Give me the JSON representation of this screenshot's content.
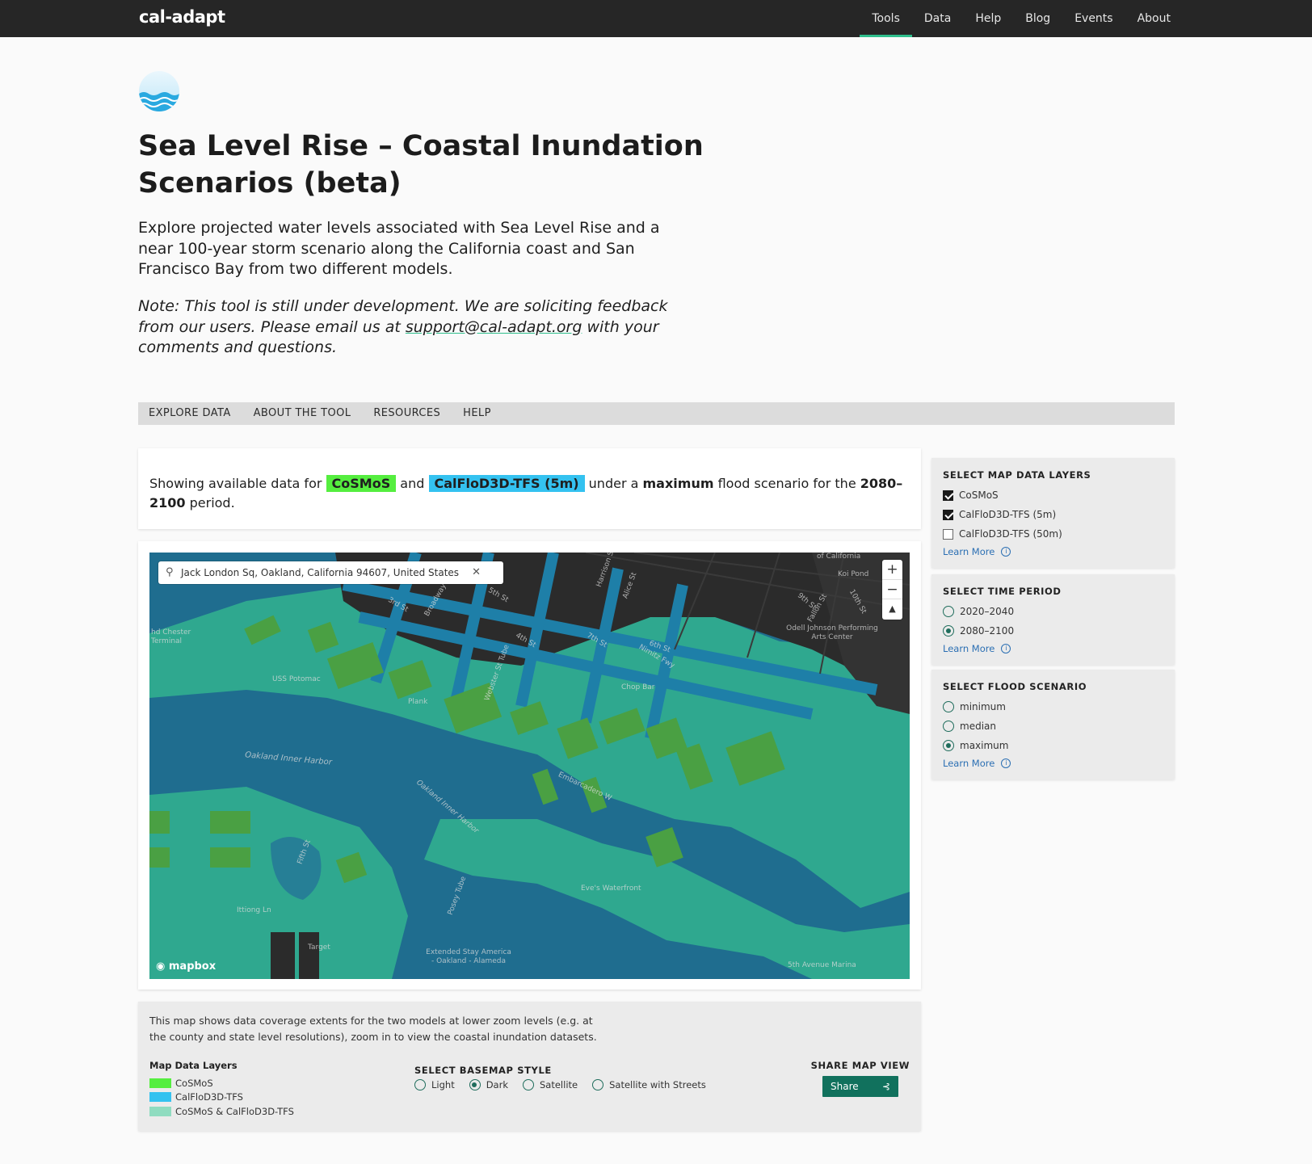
{
  "brand": {
    "logo": "cal-adapt"
  },
  "nav": {
    "items": [
      "Tools",
      "Data",
      "Help",
      "Blog",
      "Events",
      "About"
    ]
  },
  "header": {
    "title": "Sea Level Rise – Coastal Inundation Scenarios (beta)",
    "intro": "Explore projected water levels associated with Sea Level Rise and a near 100-year storm scenario along the California coast and San Francisco Bay from two different models.",
    "note_before": "Note: This tool is still under development. We are soliciting feedback from our users. Please email us at ",
    "note_link": "support@cal-adapt.org",
    "note_after": " with your comments and questions."
  },
  "tabs": [
    "EXPLORE DATA",
    "ABOUT THE TOOL",
    "RESOURCES",
    "HELP"
  ],
  "summary": {
    "prefix": "Showing available data for ",
    "model1": "CoSMoS",
    "and": " and ",
    "model2": "CalFloD3D-TFS (5m)",
    "mid": " under a ",
    "scenario": "maximum",
    "mid2": " flood scenario for the ",
    "period": "2080–2100",
    "suffix": " period."
  },
  "map": {
    "search_value": "Jack London Sq, Oakland, California 94607, United States",
    "zoom_in": "+",
    "zoom_out": "−",
    "compass": "▲",
    "attribution": "mapbox",
    "labels": [
      "Oakland Inner Harbor",
      "USS Potomac",
      "Chop Bar",
      "Eve's Waterfront",
      "Odell Johnson Performing Arts Center",
      "Nimitz Fwy",
      "Embarcadero W",
      "Webster St Tube",
      "Alice St",
      "Harrison St",
      "Broadway",
      "5th St",
      "6th St",
      "3rd St",
      "4th St",
      "7th St",
      "9th St",
      "10th St",
      "Fallon St",
      "Target",
      "Extended Stay America - Oakland - Alameda",
      "5th Avenue Marina",
      "Oakland Inner Harbor",
      "Posey Tube",
      "Fifth St",
      "Ittiong Ln",
      "hd Chester Terminal",
      "of California",
      "Koi Pond",
      "Plank"
    ]
  },
  "legend": {
    "description": "This map shows data coverage extents for the two models at lower zoom levels (e.g. at the county and state level resolutions), zoom in to view the coastal inundation datasets.",
    "title": "Map Data Layers",
    "items": [
      {
        "label": "CoSMoS",
        "color": "#55ee3f"
      },
      {
        "label": "CalFloD3D-TFS",
        "color": "#34c2f0"
      },
      {
        "label": "CoSMoS & CalFloD3D-TFS",
        "color": "#8fdcc0"
      }
    ]
  },
  "basemap": {
    "title": "SELECT BASEMAP STYLE",
    "options": [
      "Light",
      "Dark",
      "Satellite",
      "Satellite with Streets"
    ],
    "selected": "Dark"
  },
  "share": {
    "title": "SHARE MAP VIEW",
    "button": "Share"
  },
  "layers_panel": {
    "title": "SELECT MAP DATA LAYERS",
    "options": [
      {
        "label": "CoSMoS",
        "checked": true
      },
      {
        "label": "CalFloD3D-TFS (5m)",
        "checked": true
      },
      {
        "label": "CalFloD3D-TFS (50m)",
        "checked": false
      }
    ],
    "learn_more": "Learn More"
  },
  "time_panel": {
    "title": "SELECT TIME PERIOD",
    "options": [
      "2020–2040",
      "2080–2100"
    ],
    "selected": "2080–2100",
    "learn_more": "Learn More"
  },
  "flood_panel": {
    "title": "SELECT FLOOD SCENARIO",
    "options": [
      "minimum",
      "median",
      "maximum"
    ],
    "selected": "maximum",
    "learn_more": "Learn More"
  },
  "colors": {
    "nav_bg": "#262626",
    "accent": "#2fbf8c",
    "cosmos": "#55ee3f",
    "calflod": "#34c2f0",
    "water": "#1f6d8f",
    "inundation": "#2fa88f",
    "share_button": "#11715d"
  }
}
